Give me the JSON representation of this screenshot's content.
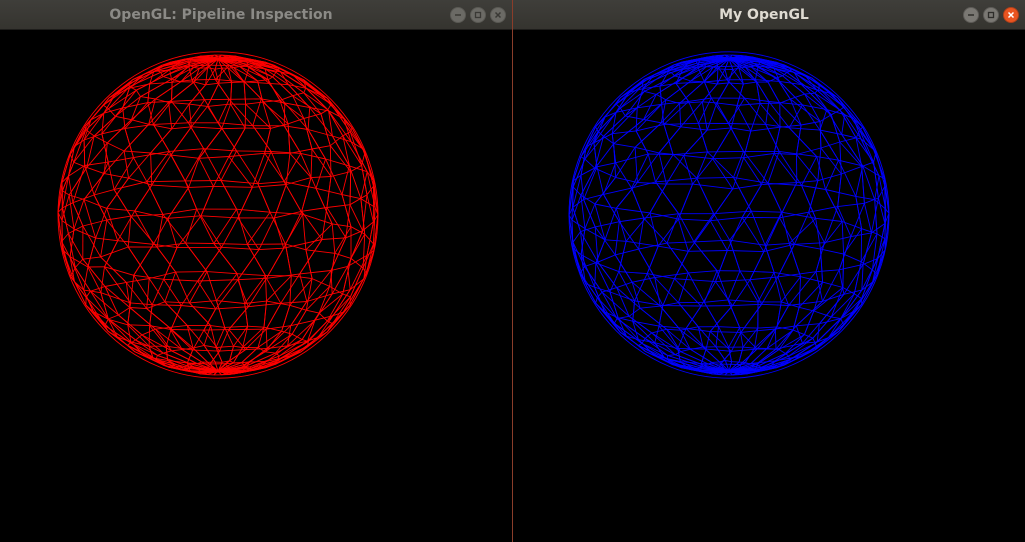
{
  "windows": [
    {
      "id": "left",
      "title": "OpenGL: Pipeline Inspection",
      "focused": false,
      "sphere_color": "#ff0000",
      "render_mode": "wireframe"
    },
    {
      "id": "right",
      "title": "My OpenGL",
      "focused": true,
      "sphere_color": "#0000ff",
      "render_mode": "wireframe"
    }
  ],
  "colors": {
    "titlebar": "#3c3b37",
    "title_inactive": "#8b8a86",
    "title_active": "#dfdbd2",
    "close_active": "#e95420",
    "background": "#000000"
  },
  "icons": {
    "minimize": "minimize-icon",
    "maximize": "maximize-icon",
    "close": "close-icon"
  }
}
